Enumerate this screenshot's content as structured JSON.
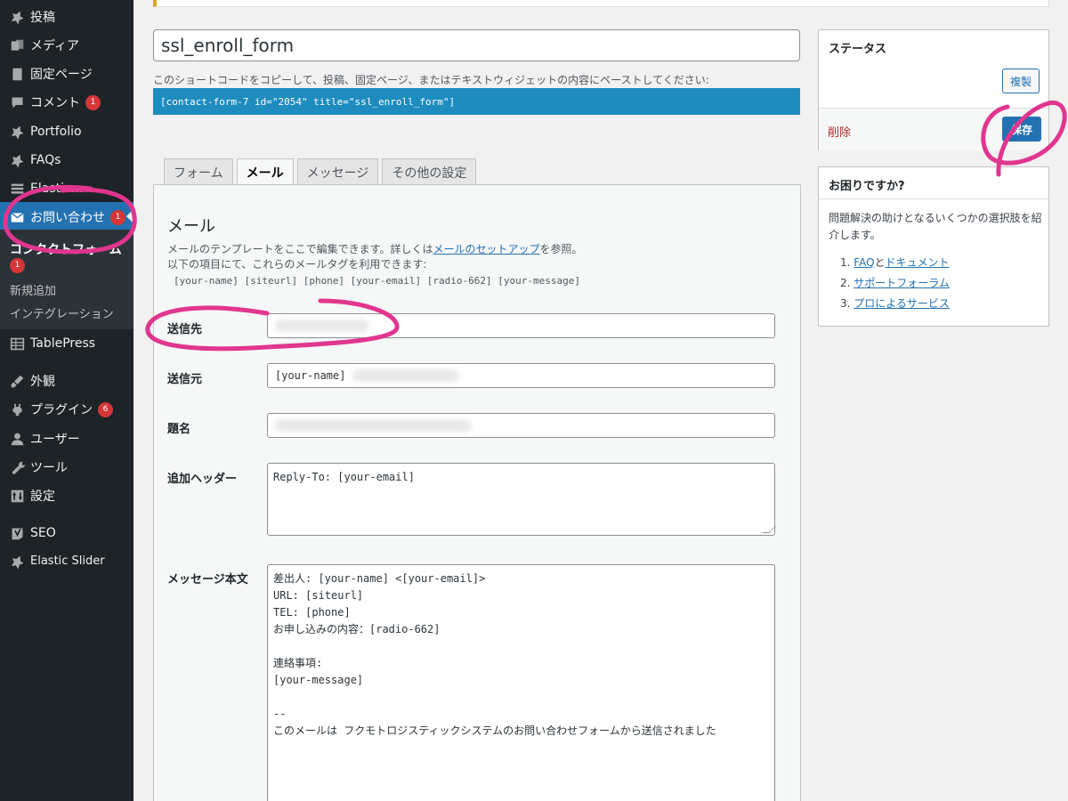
{
  "sidebar": {
    "items": [
      {
        "label": "投稿",
        "icon": "pin-icon"
      },
      {
        "label": "メディア",
        "icon": "media-icon"
      },
      {
        "label": "固定ページ",
        "icon": "page-icon"
      },
      {
        "label": "コメント",
        "icon": "comment-icon",
        "badge": "1"
      },
      {
        "label": "Portfolio",
        "icon": "pin-icon"
      },
      {
        "label": "FAQs",
        "icon": "pin-icon"
      },
      {
        "label": "Elastic...",
        "icon": "grid-icon"
      },
      {
        "label": "お問い合わせ",
        "icon": "mail-icon",
        "badge": "1"
      },
      {
        "label": "TablePress",
        "icon": "table-icon"
      },
      {
        "label": "外観",
        "icon": "brush-icon"
      },
      {
        "label": "プラグイン",
        "icon": "plugin-icon",
        "badge": "6"
      },
      {
        "label": "ユーザー",
        "icon": "user-icon"
      },
      {
        "label": "ツール",
        "icon": "wrench-icon"
      },
      {
        "label": "設定",
        "icon": "settings-icon"
      },
      {
        "label": "SEO",
        "icon": "seo-icon"
      },
      {
        "label": "Elastic Slider",
        "icon": "pin-icon"
      }
    ],
    "submenu": {
      "current": "コンタクトフォーム",
      "current_badge": "1",
      "items": [
        "新規追加",
        "インテグレーション"
      ]
    }
  },
  "form": {
    "title": "ssl_enroll_form",
    "shortcode_desc": "このショートコードをコピーして、投稿、固定ページ、またはテキストウィジェットの内容にペーストしてください:",
    "shortcode": "[contact-form-7 id=\"2054\" title=\"ssl_enroll_form\"]"
  },
  "tabs": [
    {
      "label": "フォーム",
      "active": false
    },
    {
      "label": "メール",
      "active": true
    },
    {
      "label": "メッセージ",
      "active": false
    },
    {
      "label": "その他の設定",
      "active": false
    }
  ],
  "mail": {
    "heading": "メール",
    "desc_prefix": "メールのテンプレートをここで編集できます。詳しくは",
    "desc_link": "メールのセットアップ",
    "desc_suffix": "を参照。",
    "desc_line2": "以下の項目にて、これらのメールタグを利用できます:",
    "tags": "[your-name] [siteurl] [phone] [your-email] [radio-662] [your-message]",
    "fields": {
      "to_label": "送信先",
      "from_label": "送信元",
      "from_value": "[your-name]",
      "subject_label": "題名",
      "headers_label": "追加ヘッダー",
      "headers_value": "Reply-To: [your-email]",
      "body_label": "メッセージ本文",
      "body_lines": [
        "差出人: [your-name] <[your-email]>",
        "URL: [siteurl]",
        "TEL: [phone]",
        "お申し込みの内容：[radio-662]",
        "",
        "連絡事項:",
        "[your-message]",
        "",
        "--",
        "このメールは フクモトロジスティックシステムのお問い合わせフォームから送信されました"
      ]
    }
  },
  "status_box": {
    "title": "ステータス",
    "duplicate": "複製",
    "delete": "削除",
    "save": "保存"
  },
  "help_box": {
    "title": "お困りですか?",
    "desc": "問題解決の助けとなるいくつかの選択肢を紹介します。",
    "list": [
      {
        "num": "1.",
        "parts": [
          {
            "text": "FAQ",
            "link": true
          },
          {
            "text": "と",
            "link": false
          },
          {
            "text": "ドキュメント",
            "link": true
          }
        ]
      },
      {
        "num": "2.",
        "parts": [
          {
            "text": "サポートフォーラム",
            "link": true
          }
        ]
      },
      {
        "num": "3.",
        "parts": [
          {
            "text": "プロによるサービス",
            "link": true
          }
        ]
      }
    ]
  },
  "colors": {
    "sidebar_bg": "#1d2327",
    "accent": "#2271b1",
    "shortcode_bar": "#1e8cbe",
    "badge": "#d63638",
    "annotation": "#e0368f"
  }
}
